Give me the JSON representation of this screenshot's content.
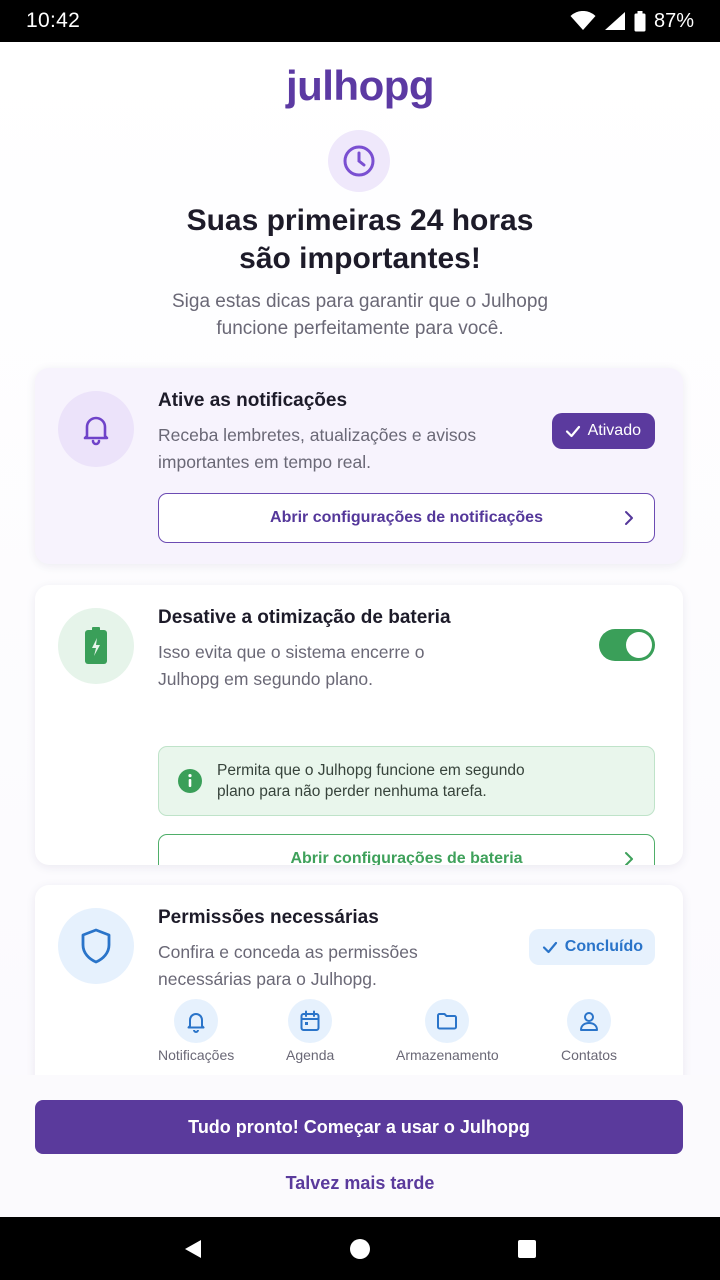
{
  "status_bar": {
    "time": "10:42",
    "battery": "87%"
  },
  "app": {
    "logo": "julhopg"
  },
  "header": {
    "title": "Suas primeiras 24 horas\nsão importantes!",
    "subtitle": "Siga estas dicas para garantir que o Julhopg\nfuncione perfeitamente para você."
  },
  "cards": {
    "notifications": {
      "title": "Ative as notificações",
      "description": "Receba lembretes, atualizações e avisos importantes em tempo real.",
      "status": "Ativado",
      "button": "Abrir configurações de notificações",
      "icon": "bell-icon"
    },
    "battery": {
      "title": "Desative a otimização de bateria",
      "description": "Isso evita que o sistema encerre o Julhopg em segundo plano.",
      "toggle_on": true,
      "info": "Permita que o Julhopg funcione em segundo\nplano para não perder nenhuma tarefa.",
      "button": "Abrir configurações de bateria",
      "icon": "battery-charging-icon"
    },
    "permissions": {
      "title": "Permissões necessárias",
      "description": "Confira e conceda as permissões necessárias para o Julhopg.",
      "status": "Concluído",
      "icon": "shield-icon",
      "items": [
        {
          "label": "Notificações",
          "icon": "bell-icon"
        },
        {
          "label": "Agenda",
          "icon": "calendar-icon"
        },
        {
          "label": "Armazenamento",
          "icon": "folder-icon"
        },
        {
          "label": "Contatos",
          "icon": "person-icon"
        }
      ]
    }
  },
  "actions": {
    "primary": "Tudo pronto! Começar a usar o Julhopg",
    "secondary": "Talvez mais tarde"
  },
  "colors": {
    "brand": "#5a3a9c",
    "success": "#3a9f59",
    "info_blue": "#2a74c9"
  }
}
